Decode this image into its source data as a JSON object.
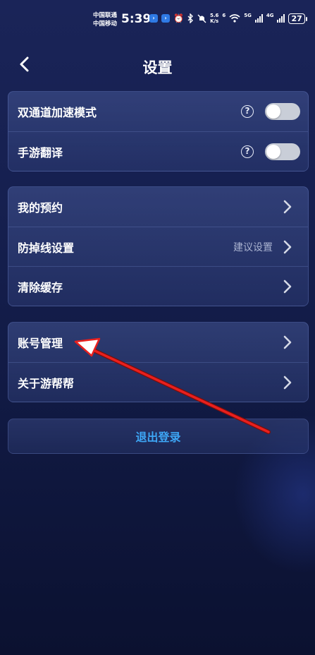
{
  "status_bar": {
    "carrier1": "中国联通",
    "carrier2": "中国移动",
    "time": "5:39",
    "speed_value": "5.6",
    "speed_unit": "K/s",
    "wifi_label": "6",
    "net1": "5G",
    "net2": "4G",
    "battery": "27"
  },
  "header": {
    "title": "设置"
  },
  "groups": [
    {
      "rows": [
        {
          "label": "双通道加速模式",
          "has_help": true,
          "toggle_on": false
        },
        {
          "label": "手游翻译",
          "has_help": true,
          "toggle_on": false
        }
      ]
    },
    {
      "rows": [
        {
          "label": "我的预约"
        },
        {
          "label": "防掉线设置",
          "hint": "建议设置"
        },
        {
          "label": "清除缓存"
        }
      ]
    },
    {
      "rows": [
        {
          "label": "账号管理"
        },
        {
          "label": "关于游帮帮"
        }
      ]
    }
  ],
  "logout_label": "退出登录",
  "colors": {
    "accent_blue": "#3da6f5",
    "annotation_red": "#e8201e",
    "toggle_off": "#c9ced8"
  },
  "icons": [
    "back-arrow-icon",
    "help-icon",
    "chevron-right-icon",
    "alarm-icon",
    "bluetooth-icon",
    "mute-icon",
    "wifi-icon",
    "signal-icon"
  ]
}
